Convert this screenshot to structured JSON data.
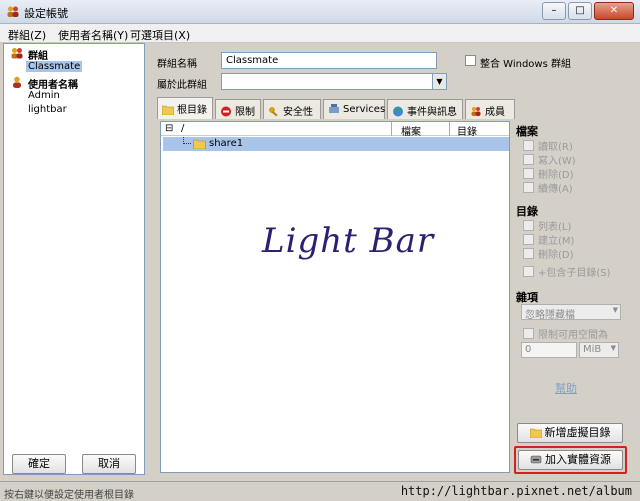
{
  "window": {
    "title": "設定帳號",
    "minimize": "–",
    "maximize": "□",
    "close": "✕"
  },
  "menu": [
    "群組(Z)",
    "使用者名稱(Y)",
    "可選項目(X)"
  ],
  "tree": {
    "groups_label": "群組",
    "group_items": [
      "Classmate"
    ],
    "users_label": "使用者名稱",
    "user_items": [
      "Admin",
      "lightbar"
    ]
  },
  "left_buttons": {
    "ok": "確定",
    "cancel": "取消"
  },
  "form": {
    "group_name_label": "群組名稱",
    "group_name_value": "Classmate",
    "windows_group_label": "整合 Windows 群組",
    "belongs_label": "屬於此群組",
    "belongs_value": ""
  },
  "tabs": [
    "根目錄",
    "限制",
    "安全性",
    "Services",
    "事件與訊息",
    "成員"
  ],
  "listview": {
    "col_path": "/",
    "col_files": "檔案",
    "col_dirs": "目錄",
    "rows": [
      {
        "name": "share1"
      }
    ],
    "toggle": "⊟"
  },
  "watermark": "Light Bar",
  "sidebar": {
    "files_title": "檔案",
    "files_options": [
      "讀取(R)",
      "寫入(W)",
      "刪除(D)",
      "續傳(A)"
    ],
    "dirs_title": "目錄",
    "dirs_options": [
      "列表(L)",
      "建立(M)",
      "刪除(D)"
    ],
    "include_subdirs": "+包含子目錄(S)",
    "misc_title": "雜項",
    "hidden_select": "忽略隱藏檔",
    "limit_space": "限制可用空間為",
    "space_value": "0",
    "space_unit": "MiB",
    "help": "幫助",
    "add_virtual_dir": "新增虛擬目錄",
    "add_physical": "加入實體資源"
  },
  "status": {
    "message": "按右鍵以便設定使用者根目錄",
    "url": "http://lightbar.pixnet.net/album"
  }
}
